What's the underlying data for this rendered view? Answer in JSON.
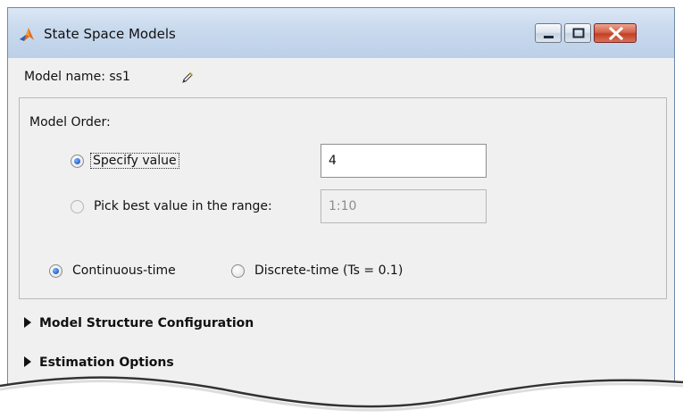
{
  "window": {
    "title": "State Space Models",
    "controls": [
      "minimize-icon",
      "maximize-icon",
      "close-icon"
    ],
    "close_color": "#c43b22"
  },
  "model_name": {
    "label": "Model name: ss1",
    "edit_icon": "pencil-icon"
  },
  "model_order": {
    "label": "Model Order:",
    "specify": {
      "label": "Specify value",
      "selected": true,
      "value": "4"
    },
    "range": {
      "label": "Pick best value in the range:",
      "selected": false,
      "value": "1:10"
    }
  },
  "time_domain": {
    "continuous": {
      "label": "Continuous-time",
      "selected": true
    },
    "discrete": {
      "label": "Discrete-time (Ts = 0.1)",
      "selected": false
    }
  },
  "sections": [
    {
      "label": "Model Structure Configuration",
      "icon": "triangle-right-icon"
    },
    {
      "label": "Estimation Options",
      "icon": "triangle-right-icon"
    }
  ],
  "colors": {
    "accent": "#2c6fd6",
    "titlebar": "#c9daee",
    "panel": "#f0f0f0"
  }
}
